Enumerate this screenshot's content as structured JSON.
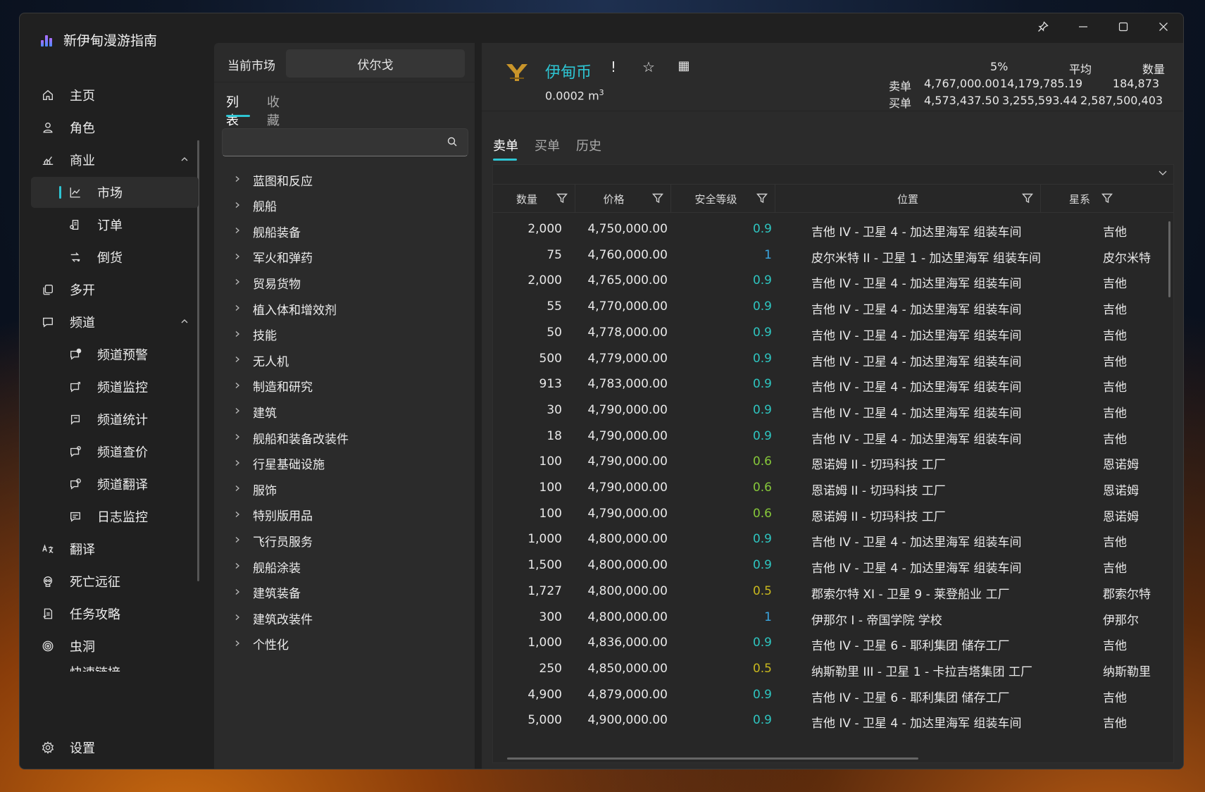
{
  "app": {
    "title": "新伊甸漫游指南"
  },
  "window_controls": [
    "pin-icon",
    "minimize-icon",
    "maximize-icon",
    "close-icon"
  ],
  "sidebar": {
    "items": [
      {
        "label": "主页",
        "icon": "home-icon",
        "level": 0
      },
      {
        "label": "角色",
        "icon": "person-icon",
        "level": 0
      },
      {
        "label": "商业",
        "icon": "chart-icon",
        "level": 0,
        "expanded": true
      },
      {
        "label": "市场",
        "icon": "trend-icon",
        "level": 1,
        "active": true
      },
      {
        "label": "订单",
        "icon": "order-icon",
        "level": 1
      },
      {
        "label": "倒货",
        "icon": "trade-icon",
        "level": 1
      },
      {
        "label": "多开",
        "icon": "copy-icon",
        "level": 0
      },
      {
        "label": "频道",
        "icon": "chat-icon",
        "level": 0,
        "expanded": true
      },
      {
        "label": "频道预警",
        "icon": "chat-alert-icon",
        "level": 1
      },
      {
        "label": "频道监控",
        "icon": "chat-monitor-icon",
        "level": 1
      },
      {
        "label": "频道统计",
        "icon": "chat-stats-icon",
        "level": 1
      },
      {
        "label": "频道查价",
        "icon": "chat-price-icon",
        "level": 1
      },
      {
        "label": "频道翻译",
        "icon": "chat-translate-icon",
        "level": 1
      },
      {
        "label": "日志监控",
        "icon": "log-icon",
        "level": 1
      },
      {
        "label": "翻译",
        "icon": "translate-icon",
        "level": 0
      },
      {
        "label": "死亡远征",
        "icon": "skull-icon",
        "level": 0
      },
      {
        "label": "任务攻略",
        "icon": "task-icon",
        "level": 0
      },
      {
        "label": "虫洞",
        "icon": "wormhole-icon",
        "level": 0
      },
      {
        "label": "快速链接",
        "icon": "link-icon",
        "level": 0
      }
    ],
    "settings_label": "设置"
  },
  "market_panel": {
    "current_market_label": "当前市场",
    "current_market_value": "伏尔戈",
    "tabs": [
      "列表",
      "收藏"
    ],
    "active_tab": 0,
    "search_placeholder": "",
    "categories": [
      "蓝图和反应",
      "舰船",
      "舰船装备",
      "军火和弹药",
      "贸易货物",
      "植入体和增效剂",
      "技能",
      "无人机",
      "制造和研究",
      "建筑",
      "舰船和装备改装件",
      "行星基础设施",
      "服饰",
      "特别版用品",
      "飞行员服务",
      "舰船涂装",
      "建筑装备",
      "建筑改装件",
      "个性化"
    ]
  },
  "item": {
    "name": "伊甸币",
    "volume": "0.0002",
    "volume_unit": "m",
    "volume_sup": "3",
    "actions": [
      "!",
      "☆",
      "▦"
    ],
    "action_icons": [
      "info-icon",
      "star-icon",
      "calculator-icon"
    ]
  },
  "stats": {
    "headers": [
      "5%",
      "平均",
      "数量"
    ],
    "rows": [
      {
        "label": "卖单",
        "values": [
          "4,767,000.00",
          "14,179,785.19",
          "184,873"
        ]
      },
      {
        "label": "买单",
        "values": [
          "4,573,437.50",
          "3,255,593.44",
          "2,587,500,403"
        ]
      }
    ]
  },
  "order_tabs": [
    "卖单",
    "买单",
    "历史"
  ],
  "active_order_tab": 0,
  "table": {
    "columns": [
      "数量",
      "价格",
      "安全等级",
      "位置",
      "星系"
    ],
    "rows": [
      [
        "2,000",
        "4,750,000.00",
        "0.9",
        "吉他 IV - 卫星 4 - 加达里海军 组装车间",
        "吉他"
      ],
      [
        "75",
        "4,760,000.00",
        "1",
        "皮尔米特 II - 卫星 1 - 加达里海军 组装车间",
        "皮尔米特"
      ],
      [
        "2,000",
        "4,765,000.00",
        "0.9",
        "吉他 IV - 卫星 4 - 加达里海军 组装车间",
        "吉他"
      ],
      [
        "55",
        "4,770,000.00",
        "0.9",
        "吉他 IV - 卫星 4 - 加达里海军 组装车间",
        "吉他"
      ],
      [
        "50",
        "4,778,000.00",
        "0.9",
        "吉他 IV - 卫星 4 - 加达里海军 组装车间",
        "吉他"
      ],
      [
        "500",
        "4,779,000.00",
        "0.9",
        "吉他 IV - 卫星 4 - 加达里海军 组装车间",
        "吉他"
      ],
      [
        "913",
        "4,783,000.00",
        "0.9",
        "吉他 IV - 卫星 4 - 加达里海军 组装车间",
        "吉他"
      ],
      [
        "30",
        "4,790,000.00",
        "0.9",
        "吉他 IV - 卫星 4 - 加达里海军 组装车间",
        "吉他"
      ],
      [
        "18",
        "4,790,000.00",
        "0.9",
        "吉他 IV - 卫星 4 - 加达里海军 组装车间",
        "吉他"
      ],
      [
        "100",
        "4,790,000.00",
        "0.6",
        "恩诺姆 II - 切玛科技 工厂",
        "恩诺姆"
      ],
      [
        "100",
        "4,790,000.00",
        "0.6",
        "恩诺姆 II - 切玛科技 工厂",
        "恩诺姆"
      ],
      [
        "100",
        "4,790,000.00",
        "0.6",
        "恩诺姆 II - 切玛科技 工厂",
        "恩诺姆"
      ],
      [
        "1,000",
        "4,800,000.00",
        "0.9",
        "吉他 IV - 卫星 4 - 加达里海军 组装车间",
        "吉他"
      ],
      [
        "1,500",
        "4,800,000.00",
        "0.9",
        "吉他 IV - 卫星 4 - 加达里海军 组装车间",
        "吉他"
      ],
      [
        "1,727",
        "4,800,000.00",
        "0.5",
        "郡索尔特 XI - 卫星 9 - 莱登船业 工厂",
        "郡索尔特"
      ],
      [
        "300",
        "4,800,000.00",
        "1",
        "伊那尔 I - 帝国学院 学校",
        "伊那尔"
      ],
      [
        "1,000",
        "4,836,000.00",
        "0.9",
        "吉他 IV - 卫星 6 - 耶利集团 储存工厂",
        "吉他"
      ],
      [
        "250",
        "4,850,000.00",
        "0.5",
        "纳斯勒里 III - 卫星 1 - 卡拉吉塔集团 工厂",
        "纳斯勒里"
      ],
      [
        "4,900",
        "4,879,000.00",
        "0.9",
        "吉他 IV - 卫星 6 - 耶利集团 储存工厂",
        "吉他"
      ],
      [
        "5,000",
        "4,900,000.00",
        "0.9",
        "吉他 IV - 卫星 4 - 加达里海军 组装车间",
        "吉他"
      ]
    ]
  },
  "colors": {
    "accent": "#2ec5d3",
    "sec_1.0": "#3aa6e0",
    "sec_0.9": "#2ec5c0",
    "sec_0.6": "#86c83a",
    "sec_0.5": "#c8b81e",
    "icon_gold": "#c9952a"
  }
}
